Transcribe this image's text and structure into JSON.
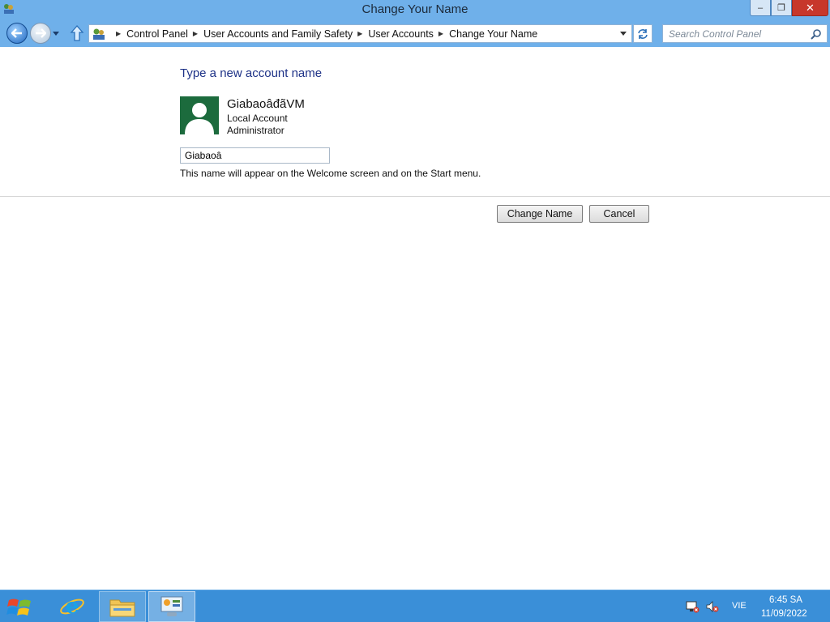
{
  "window": {
    "title": "Change Your Name",
    "buttons": {
      "minimize": "–",
      "maximize": "❐",
      "close": "✕"
    }
  },
  "address_bar": {
    "breadcrumbs": [
      "Control Panel",
      "User Accounts and Family Safety",
      "User Accounts",
      "Change Your Name"
    ],
    "search_placeholder": "Search Control Panel"
  },
  "content": {
    "heading": "Type a new account name",
    "account": {
      "name": "GiabaoâđãVM",
      "type": "Local Account",
      "role": "Administrator"
    },
    "name_input_value": "Giabaoâ",
    "hint": "This name will appear on the Welcome screen and on the Start menu.",
    "change_button": "Change Name",
    "cancel_button": "Cancel"
  },
  "taskbar": {
    "language": "VIE",
    "time": "6:45 SA",
    "date": "11/09/2022"
  },
  "colors": {
    "title_bar": "#6fb0ea",
    "heading": "#1e3287",
    "avatar_bg": "#1c6b3d",
    "taskbar": "#3a8fd8",
    "close_button": "#c7372b"
  },
  "icons": [
    "control-panel-icon",
    "back-arrow-icon",
    "forward-arrow-icon",
    "up-arrow-icon",
    "refresh-icon",
    "search-icon",
    "user-avatar-icon",
    "windows-logo-icon",
    "internet-explorer-icon",
    "file-explorer-icon",
    "control-panel-taskbar-icon",
    "network-icon",
    "volume-muted-icon"
  ]
}
